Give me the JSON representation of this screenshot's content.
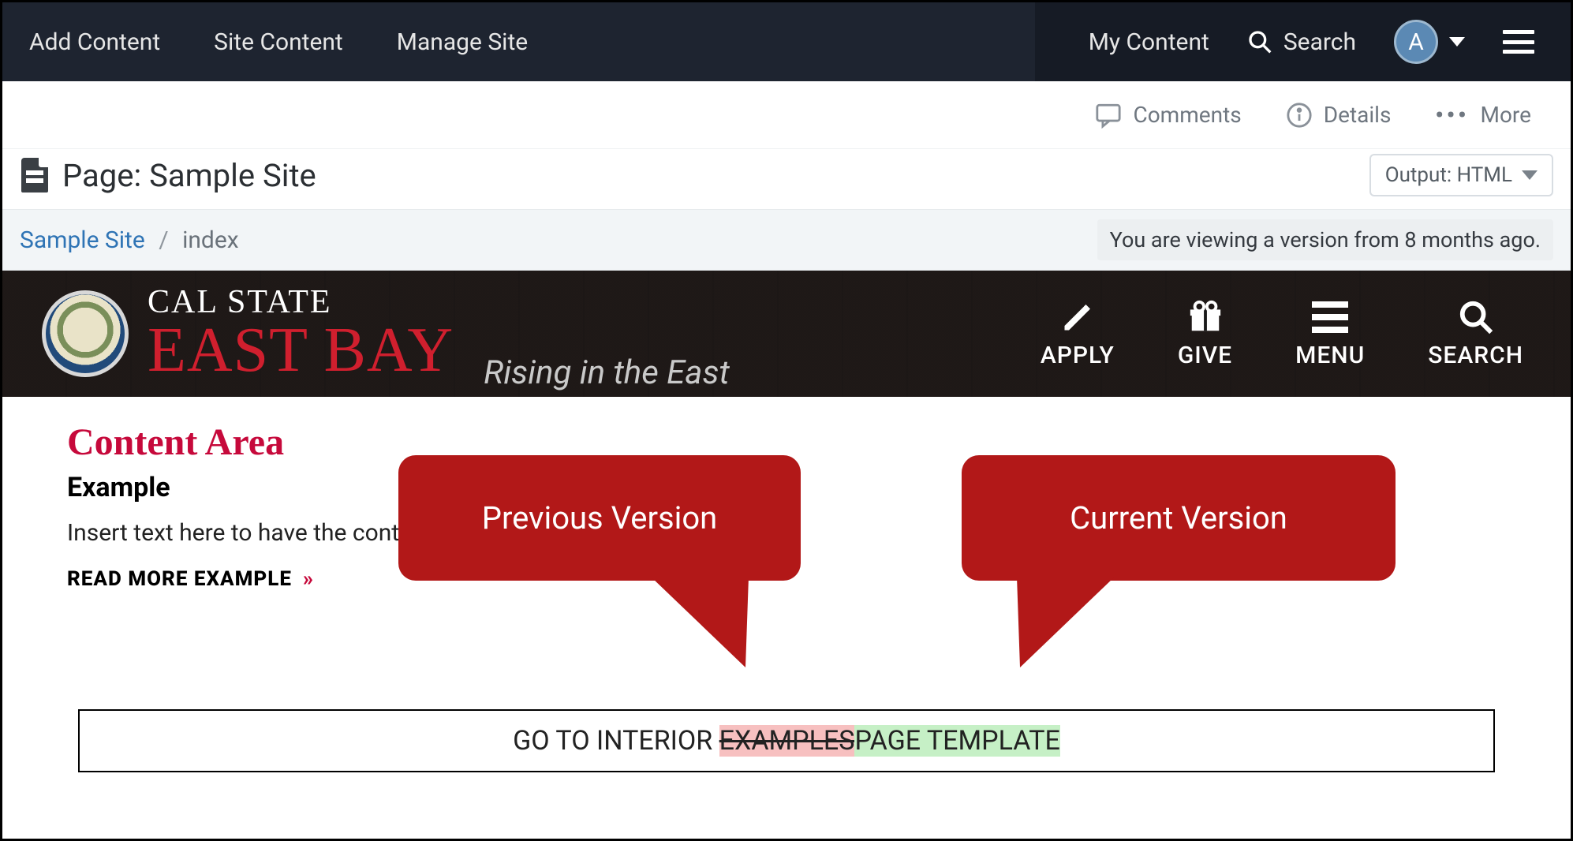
{
  "topnav": {
    "left": {
      "add_content": "Add Content",
      "site_content": "Site Content",
      "manage_site": "Manage Site"
    },
    "right": {
      "my_content": "My Content",
      "search": "Search",
      "avatar_initial": "A"
    }
  },
  "subbar": {
    "comments": "Comments",
    "details": "Details",
    "more": "More"
  },
  "page": {
    "title_prefix": "Page: ",
    "title_name": "Sample Site",
    "output_label": "Output: HTML"
  },
  "crumbs": {
    "root": "Sample Site",
    "current": "index",
    "version_note": "You are viewing a version from 8 months ago."
  },
  "site": {
    "brand_top": "CAL STATE",
    "brand_main": "EAST BAY",
    "brand_tag": "Rising in the East",
    "nav": {
      "apply": "APPLY",
      "give": "GIVE",
      "menu": "MENU",
      "search": "SEARCH"
    }
  },
  "content": {
    "heading": "Content Area",
    "sub": "Example",
    "para": "Insert text here to have the cont",
    "read_more": "READ MORE EXAMPLE"
  },
  "diff": {
    "prefix": "GO TO INTERIOR ",
    "removed": "EXAMPLES",
    "added": "PAGE TEMPLATE"
  },
  "callouts": {
    "previous": "Previous Version",
    "current": "Current Version"
  }
}
